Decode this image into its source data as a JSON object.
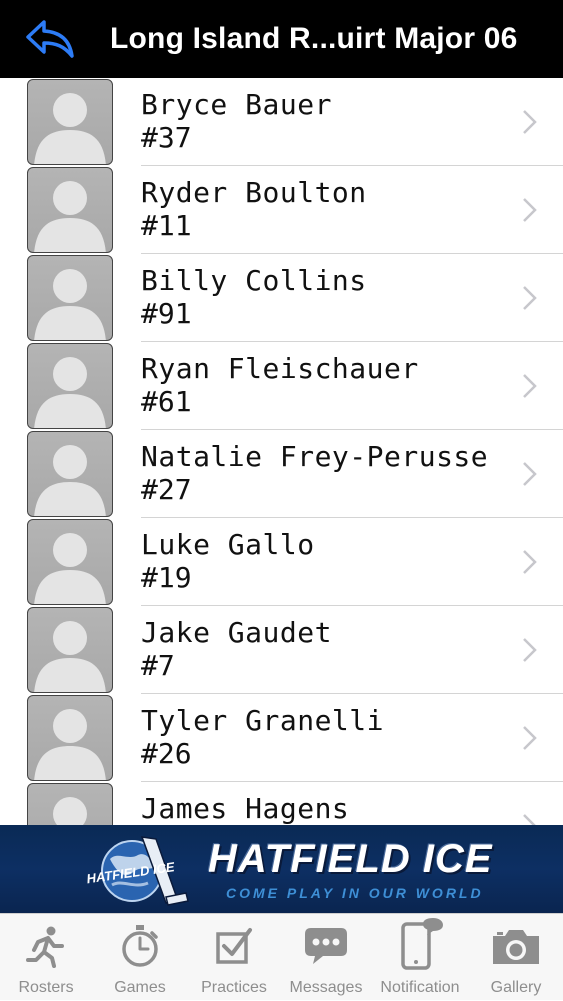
{
  "nav": {
    "title": "Long Island R...uirt Major 06",
    "back_icon": "back-arrow-icon",
    "back_color": "#2d7cf6"
  },
  "players": [
    {
      "name": "Bryce Bauer",
      "number": "#37"
    },
    {
      "name": "Ryder Boulton",
      "number": "#11"
    },
    {
      "name": "Billy Collins",
      "number": "#91"
    },
    {
      "name": "Ryan Fleischauer",
      "number": "#61"
    },
    {
      "name": "Natalie Frey-Perusse",
      "number": "#27"
    },
    {
      "name": "Luke Gallo",
      "number": "#19"
    },
    {
      "name": "Jake Gaudet",
      "number": "#7"
    },
    {
      "name": "Tyler Granelli",
      "number": "#26"
    },
    {
      "name": "James Hagens",
      "number": ""
    }
  ],
  "banner": {
    "logo_text": "HATFIELD ICE",
    "brand": "HATFIELD ICE",
    "tagline": "COME PLAY IN OUR WORLD"
  },
  "tabs": [
    {
      "label": "Rosters",
      "icon": "runner-icon"
    },
    {
      "label": "Games",
      "icon": "stopwatch-icon"
    },
    {
      "label": "Practices",
      "icon": "checkbox-icon"
    },
    {
      "label": "Messages",
      "icon": "chat-bubble-icon"
    },
    {
      "label": "Notification",
      "icon": "phone-notification-icon"
    },
    {
      "label": "Gallery",
      "icon": "camera-icon"
    }
  ],
  "colors": {
    "navbar": "#000000",
    "banner": "#0d2f63",
    "tab_inactive": "#8e8e8e"
  }
}
